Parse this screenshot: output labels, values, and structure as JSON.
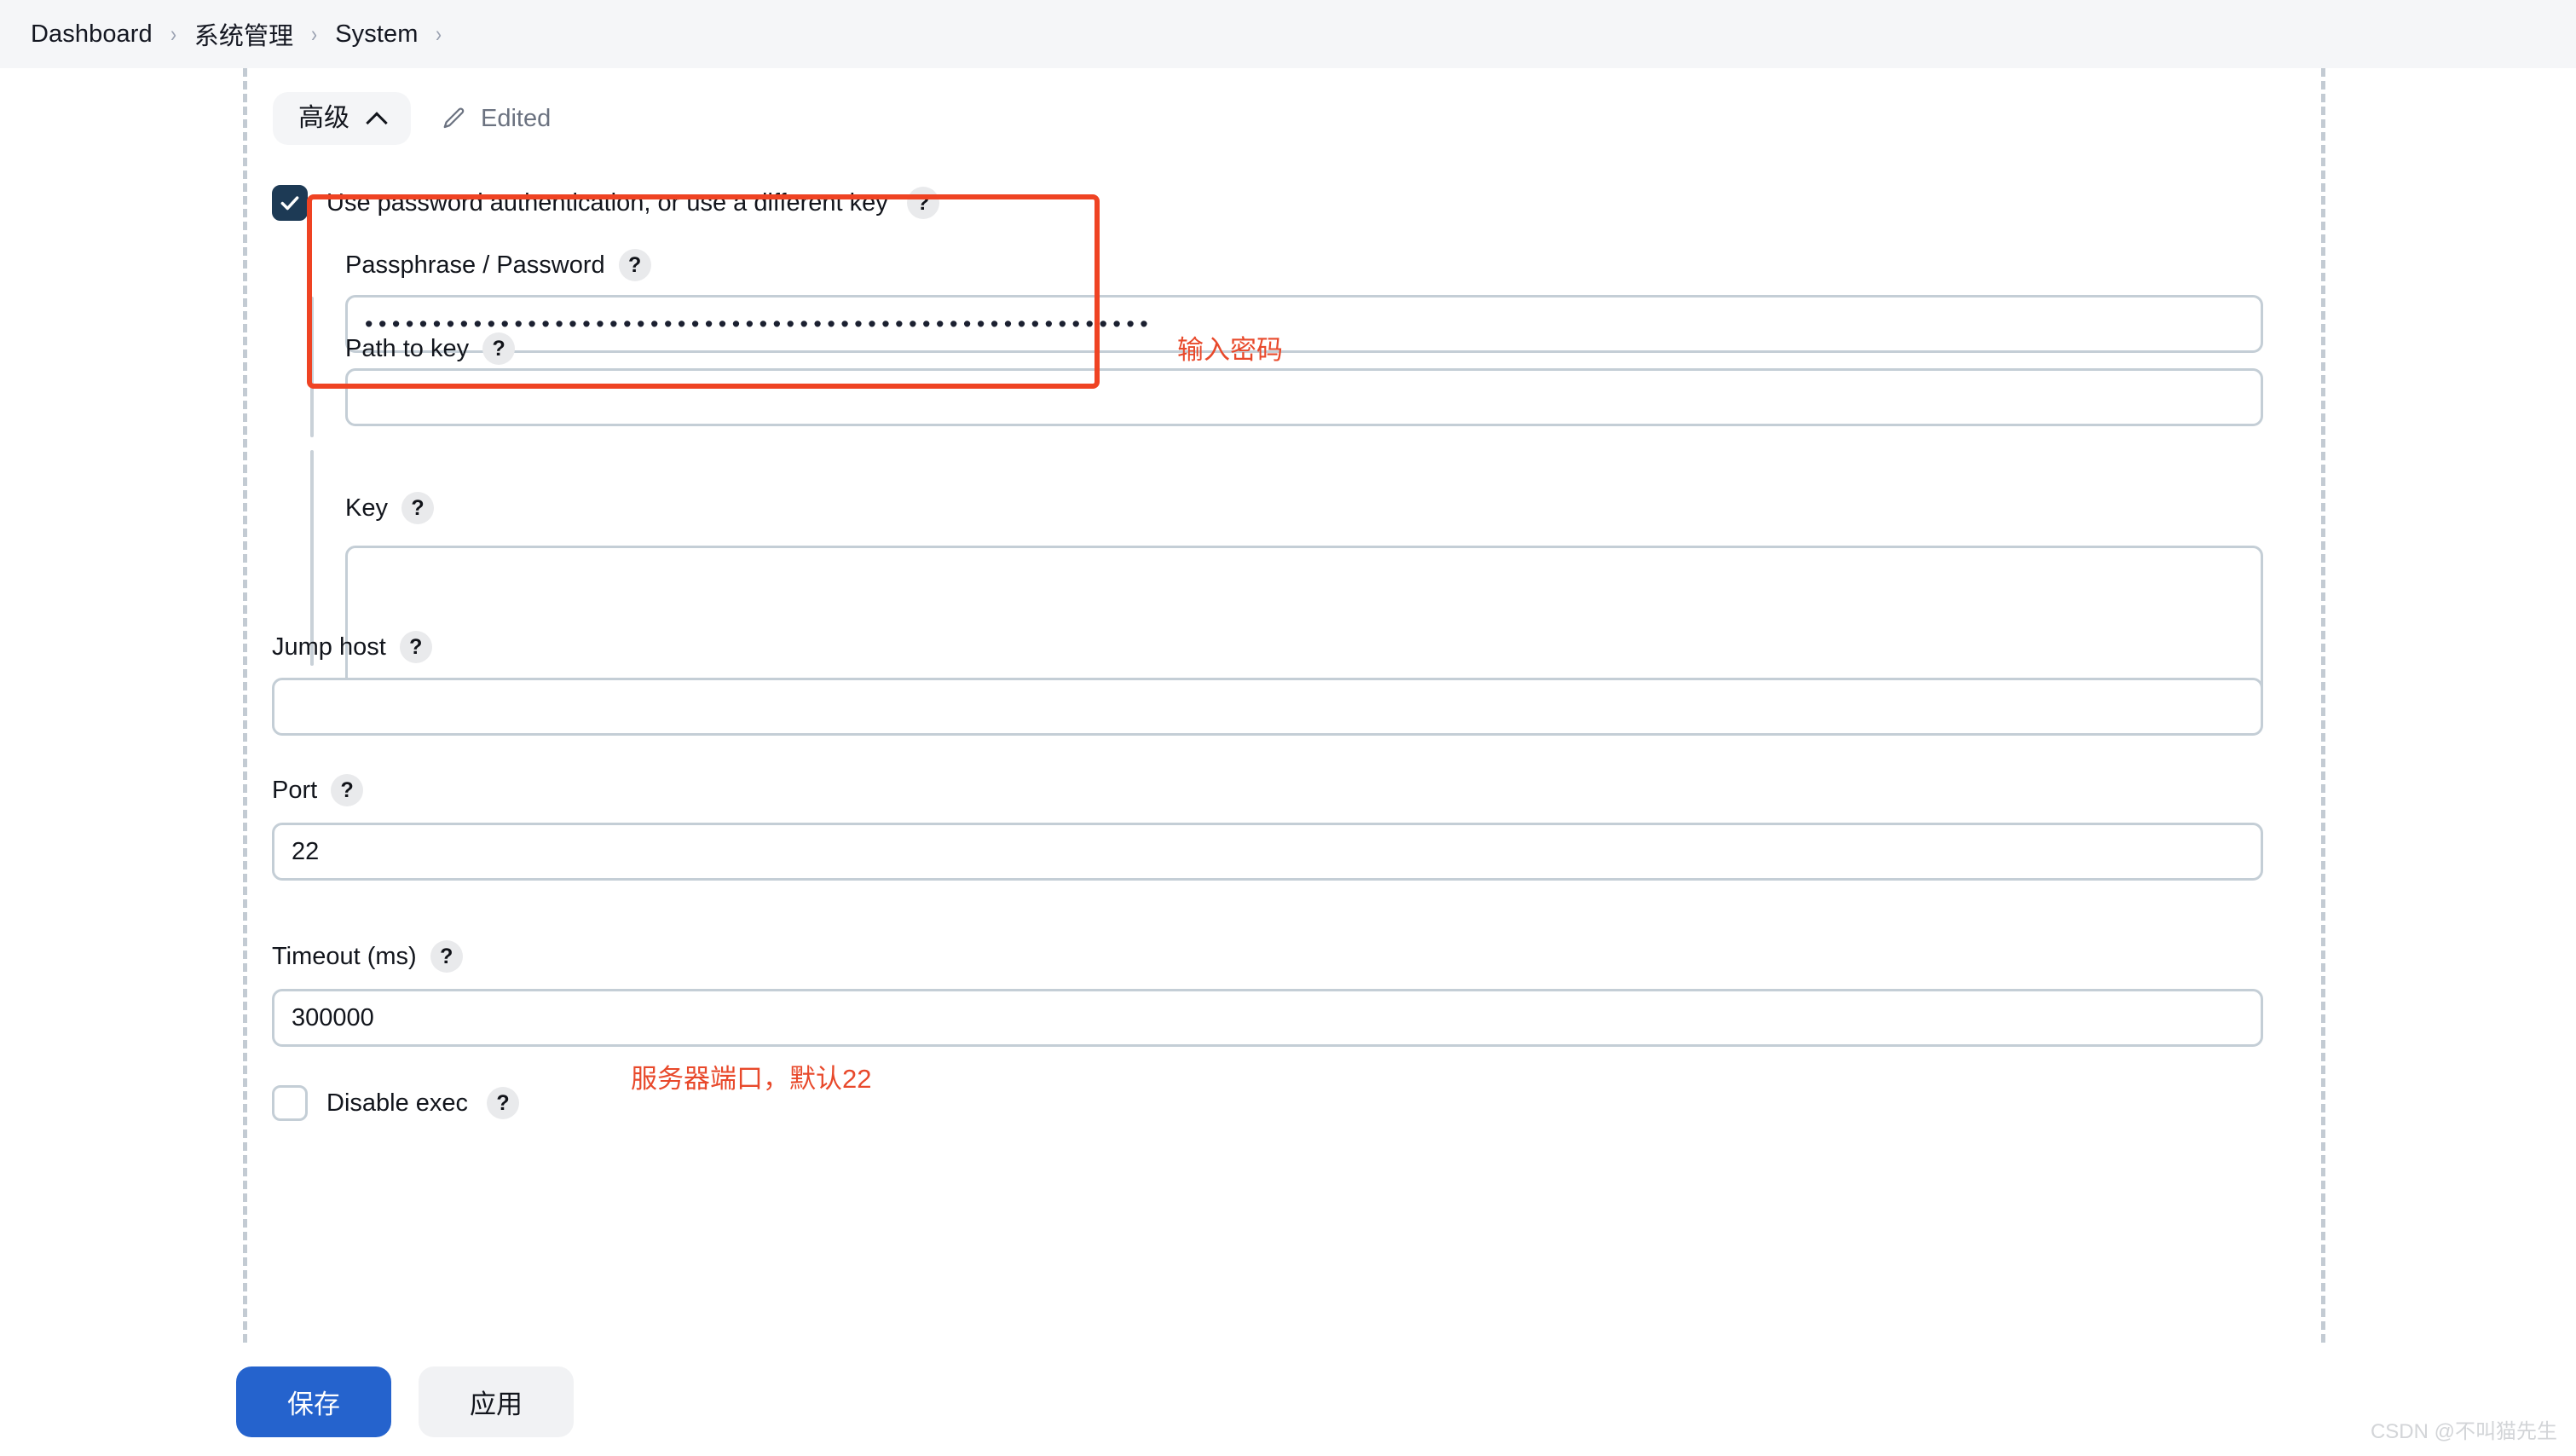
{
  "breadcrumb": {
    "items": [
      {
        "label": "Dashboard"
      },
      {
        "label": "系统管理"
      },
      {
        "label": "System"
      }
    ],
    "separator": "›"
  },
  "section": {
    "collapse_label": "高级",
    "collapse_state": "expanded",
    "edited_label": "Edited",
    "edit_icon": "pencil-icon",
    "caret_icon": "chevron-up-icon"
  },
  "help_glyph": "?",
  "form": {
    "use_password": {
      "label": "Use password authentication, or use a different key",
      "checked": true,
      "help": "?"
    },
    "passphrase": {
      "label": "Passphrase / Password",
      "help": "?",
      "value": "••••••••••••••••••••••••••••••••••••••••••••••••••••••••••",
      "placeholder": ""
    },
    "path_to_key": {
      "label": "Path to key",
      "help": "?",
      "value": "",
      "placeholder": ""
    },
    "key": {
      "label": "Key",
      "help": "?",
      "value": "",
      "placeholder": ""
    },
    "jump_host": {
      "label": "Jump host",
      "help": "?",
      "value": "",
      "placeholder": ""
    },
    "port": {
      "label": "Port",
      "help": "?",
      "value": "22",
      "placeholder": ""
    },
    "timeout": {
      "label": "Timeout (ms)",
      "help": "?",
      "value": "300000",
      "placeholder": ""
    },
    "disable_exec": {
      "label": "Disable exec",
      "checked": false,
      "help": "?"
    }
  },
  "annotations": [
    {
      "text": "输入密码",
      "color": "#e8492b"
    },
    {
      "text": "服务器端口，默认22",
      "color": "#e8492b"
    }
  ],
  "highlight": {
    "color": "#ef4323"
  },
  "footer": {
    "save_label": "保存",
    "apply_label": "应用",
    "primary_color": "#2563cd"
  },
  "watermark": {
    "text": "CSDN @不叫猫先生"
  }
}
